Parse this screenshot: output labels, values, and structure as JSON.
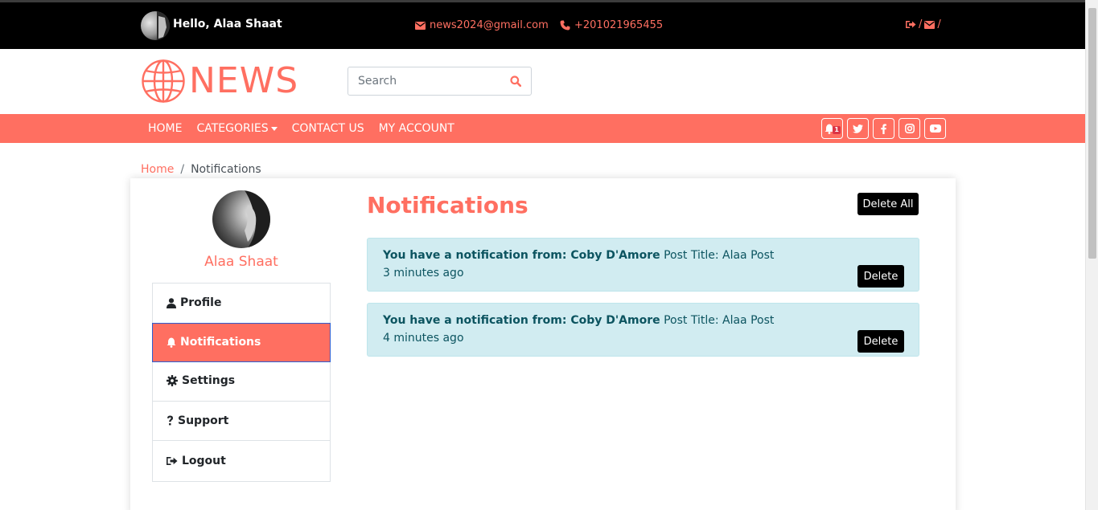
{
  "topbar": {
    "greeting": "Hello, Alaa Shaat",
    "email": "news2024@gmail.com",
    "phone": "+201021965455",
    "separator": "/"
  },
  "logo": {
    "text": "NEWS"
  },
  "search": {
    "placeholder": "Search"
  },
  "nav": {
    "home": "HOME",
    "categories": "CATEGORIES",
    "contact": "CONTACT US",
    "account": "MY ACCOUNT",
    "notification_count": "1"
  },
  "breadcrumb": {
    "home": "Home",
    "separator": "/",
    "current": "Notifications"
  },
  "profile": {
    "name": "Alaa Shaat"
  },
  "menu": {
    "profile": "Profile",
    "notifications": "Notifications",
    "settings": "Settings",
    "support": "Support",
    "logout": "Logout"
  },
  "main": {
    "title": "Notifications",
    "delete_all": "Delete All",
    "notifications": [
      {
        "prefix": "You have a notification from: Coby D'Amore",
        "post": "Post Title: Alaa Post",
        "time": "3 minutes ago",
        "delete": "Delete"
      },
      {
        "prefix": "You have a notification from: Coby D'Amore",
        "post": "Post Title: Alaa Post",
        "time": "4 minutes ago",
        "delete": "Delete"
      }
    ]
  },
  "colors": {
    "accent": "#ff6f61",
    "alert_bg": "#d1ecf1",
    "alert_text": "#0c5460"
  }
}
